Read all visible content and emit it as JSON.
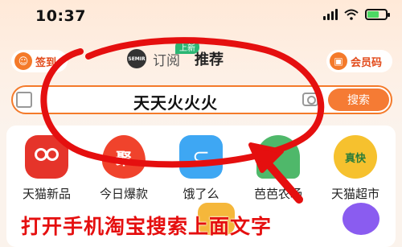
{
  "status": {
    "time": "10:37"
  },
  "header": {
    "left_pill": "签到",
    "right_pill": "会员码",
    "tab_subscribe": "订阅",
    "tab_subscribe_badge": "上新",
    "tab_recommend": "推荐",
    "logo_text": "SEMIR"
  },
  "search": {
    "query": "天天火火火",
    "button": "搜索"
  },
  "grid": {
    "items": [
      {
        "label": "天猫新品",
        "icon": "tmall-new-icon"
      },
      {
        "label": "今日爆款",
        "icon": "hot-deal-icon",
        "glyph": "聚"
      },
      {
        "label": "饿了么",
        "icon": "eleme-icon",
        "glyph": "⊂"
      },
      {
        "label": "芭芭农场",
        "icon": "farm-icon"
      },
      {
        "label": "天猫超市",
        "icon": "tmall-supermarket-icon",
        "glyph": "真快"
      }
    ]
  },
  "annotation": {
    "caption": "打开手机淘宝搜索上面文字"
  },
  "colors": {
    "accent": "#f57b34",
    "annotation": "#e50f0f"
  }
}
